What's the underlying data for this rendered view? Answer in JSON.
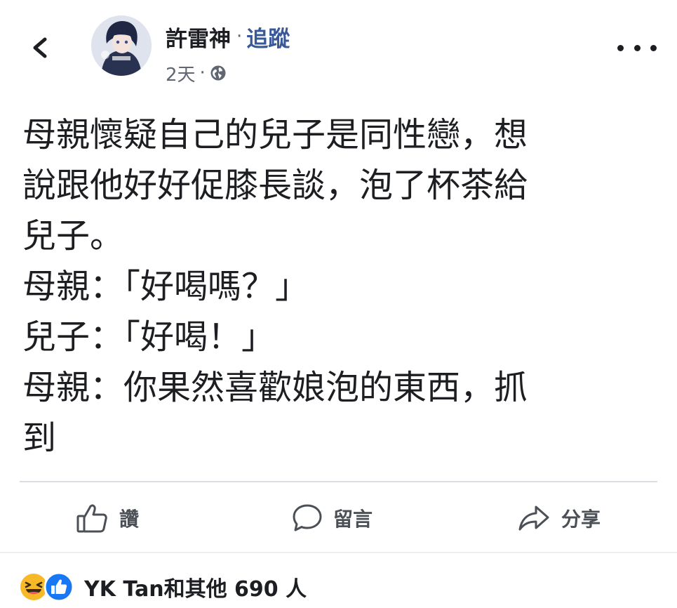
{
  "header": {
    "author_name": "許雷神",
    "separator": "·",
    "follow_label": "追蹤",
    "post_time": "2天",
    "meta_separator": "·",
    "audience_icon": "globe-icon",
    "back_icon": "chevron-left-icon",
    "more_icon": "more-horizontal-icon"
  },
  "post": {
    "lines": [
      "母親懷疑自己的兒子是同性戀，想",
      "說跟他好好促膝長談，泡了杯茶給",
      "兒子。",
      "母親：「好喝嗎？」",
      "兒子：「好喝！」",
      "母親：你果然喜歡娘泡的東西，抓",
      "到"
    ]
  },
  "actions": {
    "like_label": "讚",
    "comment_label": "留言",
    "share_label": "分享"
  },
  "reactions": {
    "summary": "YK Tan和其他 690 人",
    "icons": [
      "haha-icon",
      "like-icon"
    ]
  },
  "colors": {
    "text": "#1c1e21",
    "secondary": "#606770",
    "link": "#385898",
    "like_blue": "#1877f2",
    "haha_yellow": "#f7b928"
  }
}
